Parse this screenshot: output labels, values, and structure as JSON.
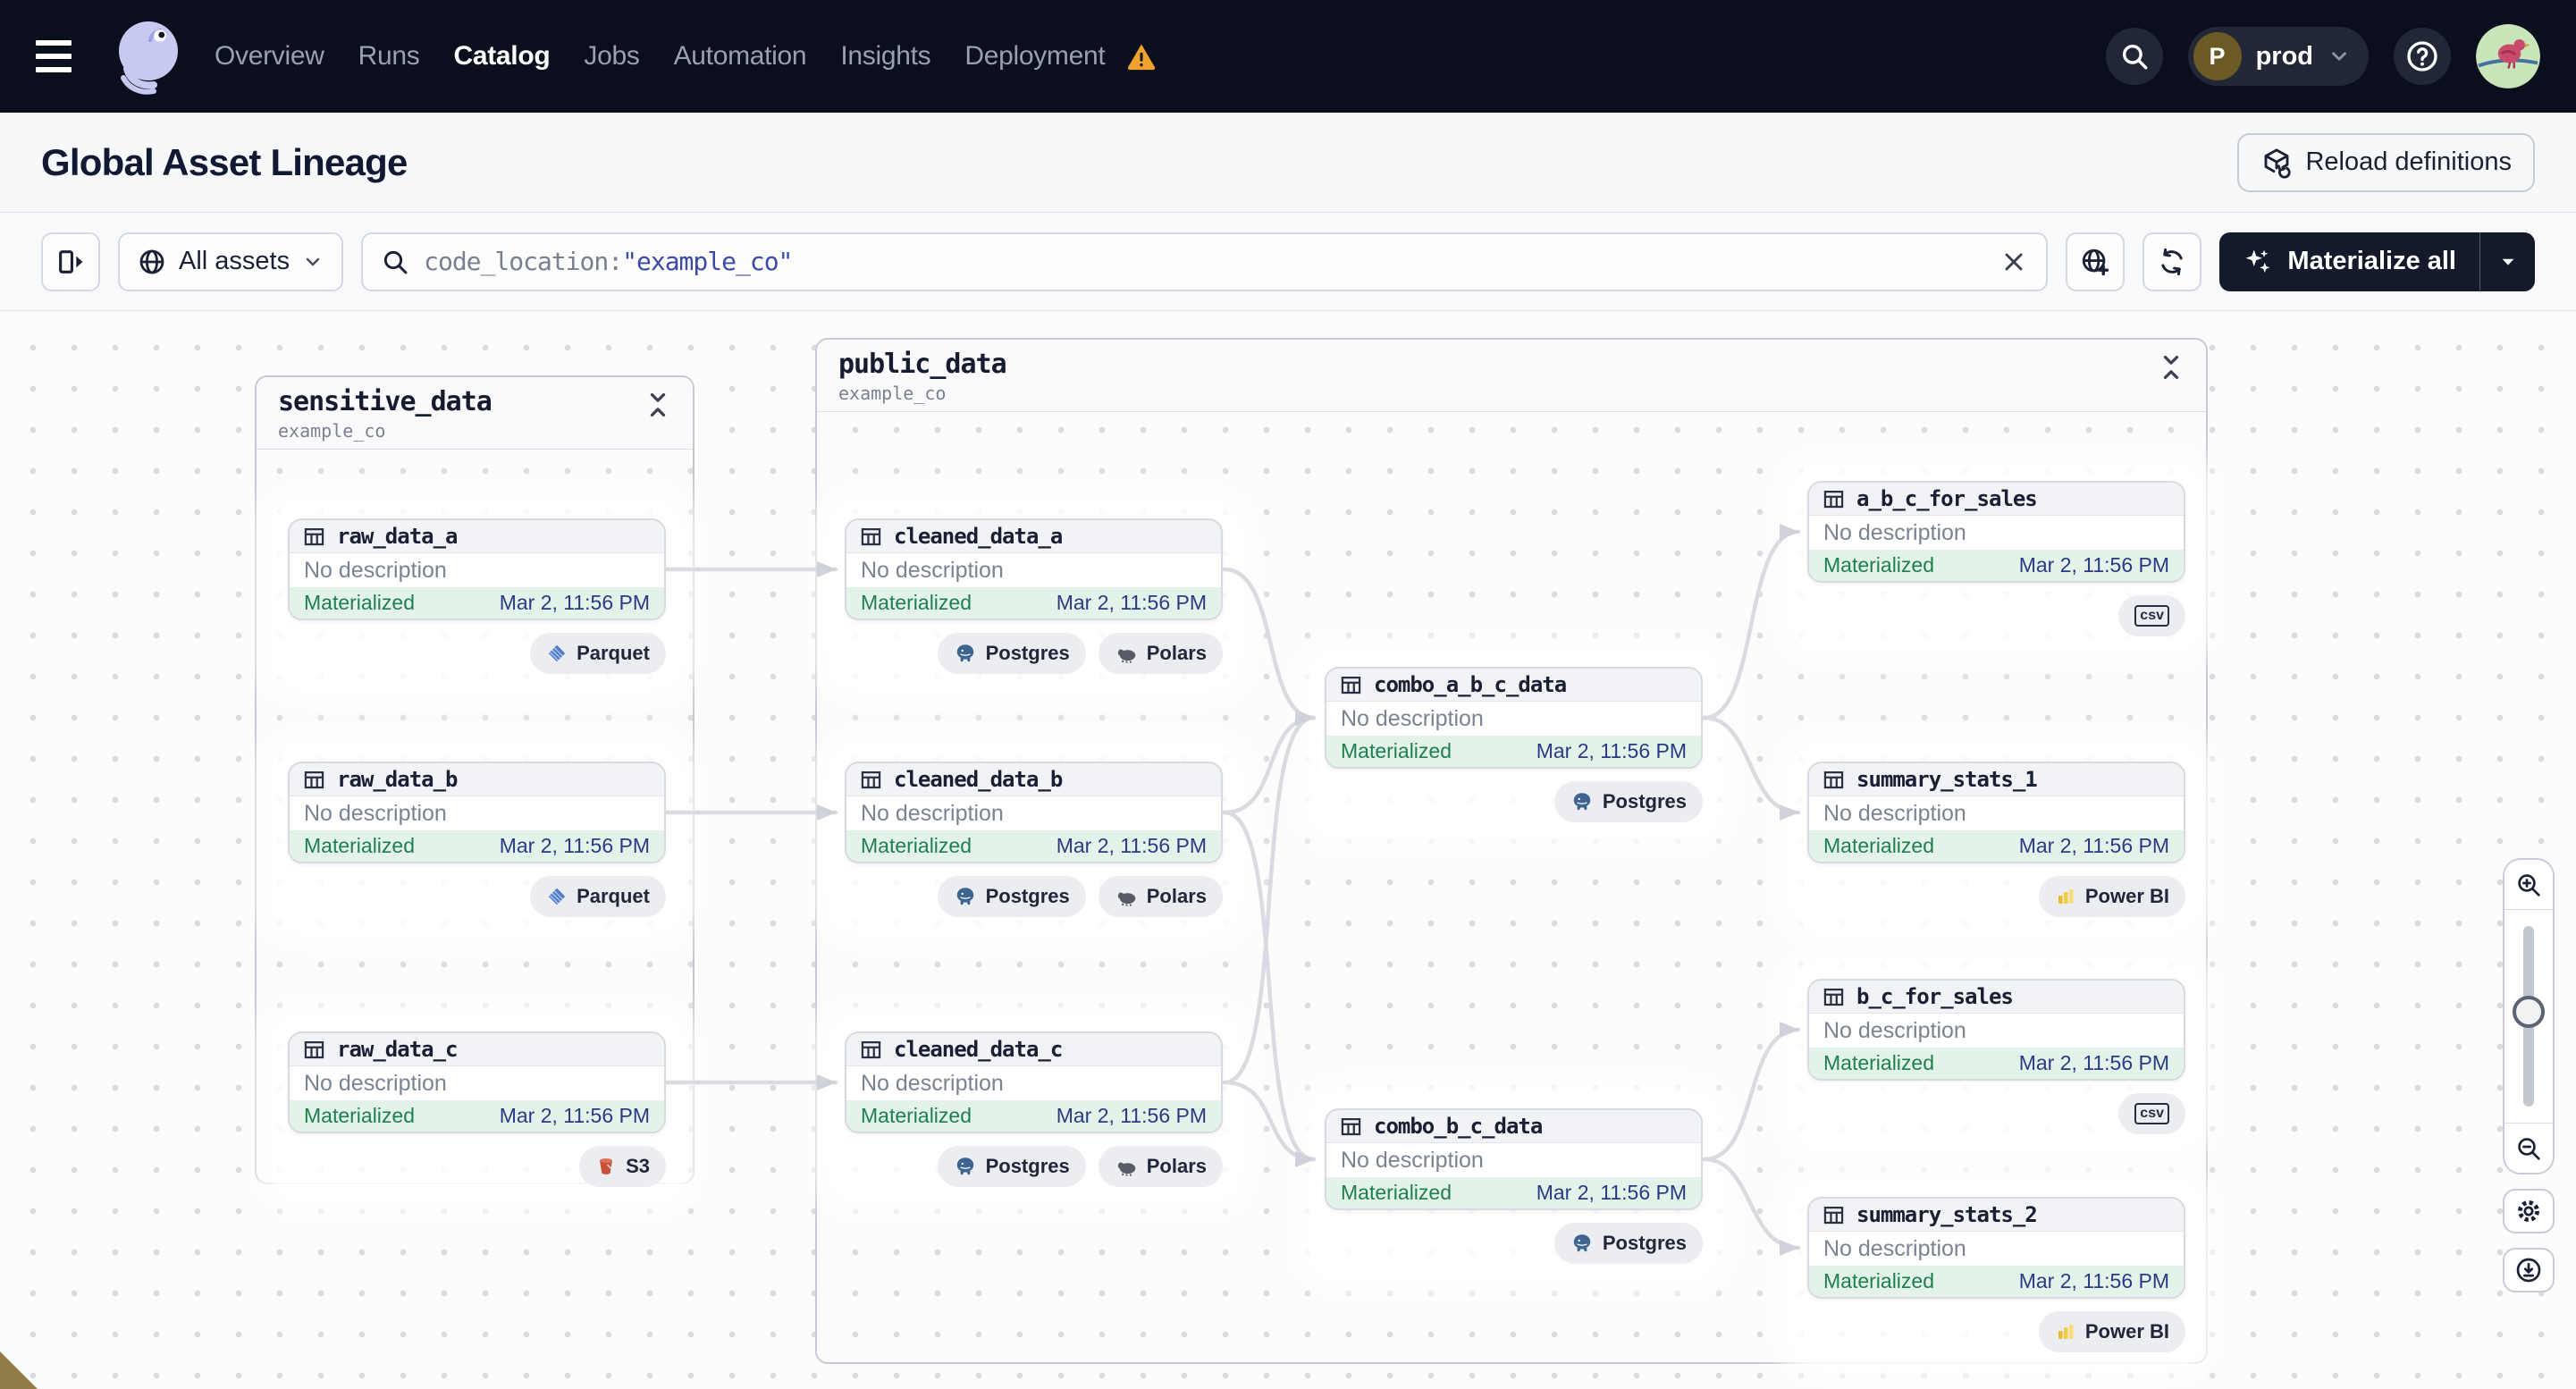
{
  "nav": {
    "items": [
      "Overview",
      "Runs",
      "Catalog",
      "Jobs",
      "Automation",
      "Insights",
      "Deployment"
    ],
    "active_item": "Catalog",
    "environment": {
      "initial": "P",
      "label": "prod"
    }
  },
  "header": {
    "title": "Global Asset Lineage",
    "reload_label": "Reload definitions"
  },
  "toolbar": {
    "filter_label": "All assets",
    "search_prefix": "code_location:",
    "search_value": "\"example_co\"",
    "materialize_label": "Materialize all"
  },
  "groups": [
    {
      "name": "sensitive_data",
      "code_location": "example_co",
      "nodes": [
        {
          "name": "raw_data_a",
          "description": "No description",
          "status": "Materialized",
          "time": "Mar 2, 11:56 PM",
          "tags": [
            {
              "label": "Parquet",
              "icon": "parquet-icon"
            }
          ]
        },
        {
          "name": "raw_data_b",
          "description": "No description",
          "status": "Materialized",
          "time": "Mar 2, 11:56 PM",
          "tags": [
            {
              "label": "Parquet",
              "icon": "parquet-icon"
            }
          ]
        },
        {
          "name": "raw_data_c",
          "description": "No description",
          "status": "Materialized",
          "time": "Mar 2, 11:56 PM",
          "tags": [
            {
              "label": "S3",
              "icon": "s3-icon"
            }
          ]
        }
      ]
    },
    {
      "name": "public_data",
      "code_location": "example_co",
      "nodes": [
        {
          "name": "cleaned_data_a",
          "description": "No description",
          "status": "Materialized",
          "time": "Mar 2, 11:56 PM",
          "tags": [
            {
              "label": "Postgres",
              "icon": "postgres-icon"
            },
            {
              "label": "Polars",
              "icon": "polars-icon"
            }
          ]
        },
        {
          "name": "cleaned_data_b",
          "description": "No description",
          "status": "Materialized",
          "time": "Mar 2, 11:56 PM",
          "tags": [
            {
              "label": "Postgres",
              "icon": "postgres-icon"
            },
            {
              "label": "Polars",
              "icon": "polars-icon"
            }
          ]
        },
        {
          "name": "cleaned_data_c",
          "description": "No description",
          "status": "Materialized",
          "time": "Mar 2, 11:56 PM",
          "tags": [
            {
              "label": "Postgres",
              "icon": "postgres-icon"
            },
            {
              "label": "Polars",
              "icon": "polars-icon"
            }
          ]
        },
        {
          "name": "combo_a_b_c_data",
          "description": "No description",
          "status": "Materialized",
          "time": "Mar 2, 11:56 PM",
          "tags": [
            {
              "label": "Postgres",
              "icon": "postgres-icon"
            }
          ]
        },
        {
          "name": "combo_b_c_data",
          "description": "No description",
          "status": "Materialized",
          "time": "Mar 2, 11:56 PM",
          "tags": [
            {
              "label": "Postgres",
              "icon": "postgres-icon"
            }
          ]
        },
        {
          "name": "a_b_c_for_sales",
          "description": "No description",
          "status": "Materialized",
          "time": "Mar 2, 11:56 PM",
          "tags": [
            {
              "label": "csv",
              "icon": "csv-icon"
            }
          ]
        },
        {
          "name": "summary_stats_1",
          "description": "No description",
          "status": "Materialized",
          "time": "Mar 2, 11:56 PM",
          "tags": [
            {
              "label": "Power BI",
              "icon": "powerbi-icon"
            }
          ]
        },
        {
          "name": "b_c_for_sales",
          "description": "No description",
          "status": "Materialized",
          "time": "Mar 2, 11:56 PM",
          "tags": [
            {
              "label": "csv",
              "icon": "csv-icon"
            }
          ]
        },
        {
          "name": "summary_stats_2",
          "description": "No description",
          "status": "Materialized",
          "time": "Mar 2, 11:56 PM",
          "tags": [
            {
              "label": "Power BI",
              "icon": "powerbi-icon"
            }
          ]
        }
      ]
    }
  ],
  "edges": [
    {
      "from": "raw_data_a",
      "to": "cleaned_data_a"
    },
    {
      "from": "raw_data_b",
      "to": "cleaned_data_b"
    },
    {
      "from": "raw_data_c",
      "to": "cleaned_data_c"
    },
    {
      "from": "cleaned_data_a",
      "to": "combo_a_b_c_data"
    },
    {
      "from": "cleaned_data_b",
      "to": "combo_a_b_c_data"
    },
    {
      "from": "cleaned_data_c",
      "to": "combo_a_b_c_data"
    },
    {
      "from": "cleaned_data_b",
      "to": "combo_b_c_data"
    },
    {
      "from": "cleaned_data_c",
      "to": "combo_b_c_data"
    },
    {
      "from": "combo_a_b_c_data",
      "to": "a_b_c_for_sales"
    },
    {
      "from": "combo_a_b_c_data",
      "to": "summary_stats_1"
    },
    {
      "from": "combo_b_c_data",
      "to": "b_c_for_sales"
    },
    {
      "from": "combo_b_c_data",
      "to": "summary_stats_2"
    }
  ],
  "colors": {
    "topnav_bg": "#0A0E1D",
    "accent_dark": "#141A2C",
    "status_green": "#1E7F4F",
    "timestamp_blue": "#2B3A85",
    "warning_orange": "#EFA22D",
    "edge_gray": "#D9DBE1",
    "search_value_blue": "#3A4AA8"
  }
}
